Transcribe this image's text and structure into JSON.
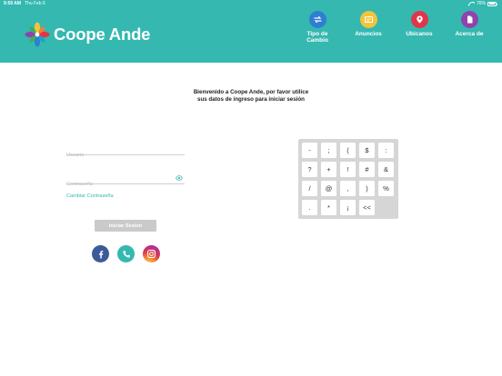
{
  "status_bar": {
    "time": "9:59 AM",
    "date": "Thu Feb 6",
    "battery": "76%"
  },
  "header": {
    "logo_text": "Coope Ande",
    "nav": [
      {
        "label_line1": "Tipo de",
        "label_line2": "Cambio",
        "icon": "currency-exchange-icon",
        "color": "#2f7fd1"
      },
      {
        "label_line1": "Anuncios",
        "label_line2": "",
        "icon": "megaphone-icon",
        "color": "#f2c53d"
      },
      {
        "label_line1": "Ubicanos",
        "label_line2": "",
        "icon": "location-pin-icon",
        "color": "#e1354a"
      },
      {
        "label_line1": "Acerca de",
        "label_line2": "",
        "icon": "document-icon",
        "color": "#8f44ad"
      }
    ]
  },
  "welcome": {
    "line1": "Bienvenido a Coope Ande, por favor utilice",
    "line2": "sus datos de ingreso para iniciar sesión"
  },
  "form": {
    "username_placeholder": "Usuario",
    "password_placeholder": "Contraseña",
    "change_password": "Cambiar Contraseña",
    "login_button": "Iniciar Sesion"
  },
  "keypad": {
    "rows": [
      [
        "-",
        ";",
        "(",
        "$",
        ":"
      ],
      [
        "?",
        "+",
        "!",
        "#",
        "&"
      ],
      [
        "/",
        "@",
        ",",
        ")",
        "%"
      ],
      [
        ".",
        "*",
        "¡",
        "<<"
      ]
    ]
  },
  "colors": {
    "brand": "#34b8b0",
    "facebook": "#3c5a99"
  }
}
